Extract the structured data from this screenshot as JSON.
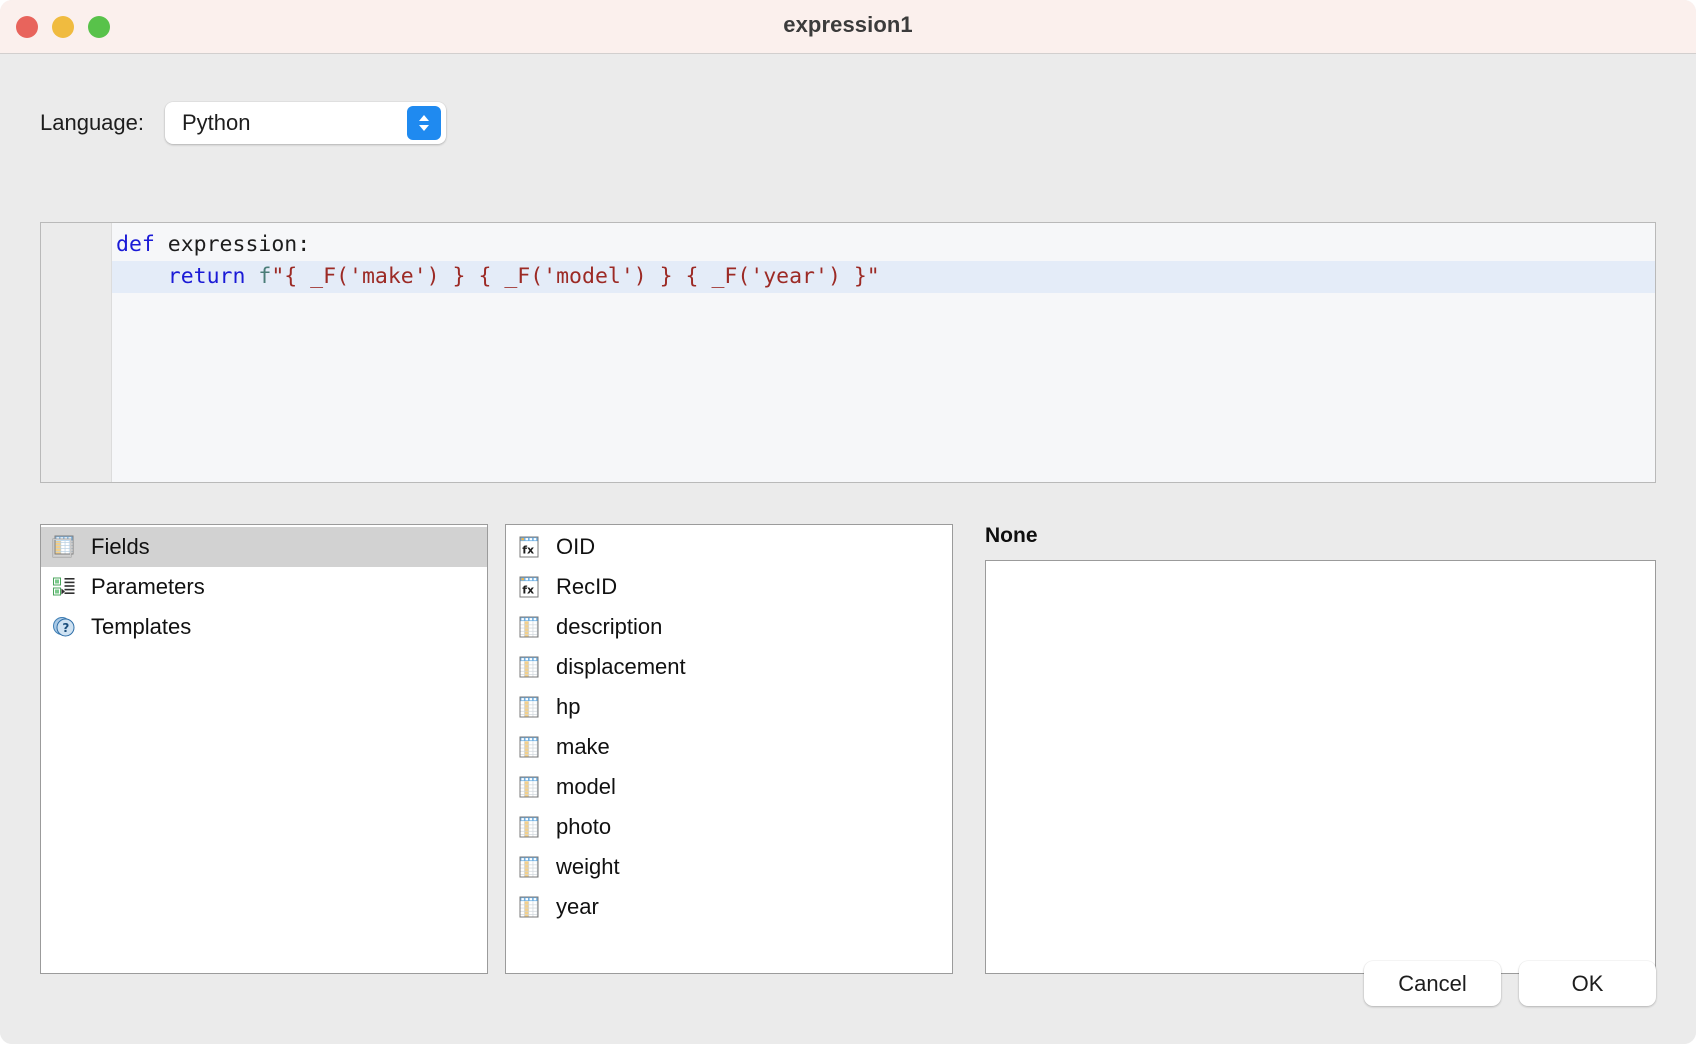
{
  "window": {
    "title": "expression1",
    "traffic_lights": [
      {
        "name": "close-button",
        "color": "#e8645c"
      },
      {
        "name": "minimize-button",
        "color": "#f0bb3f"
      },
      {
        "name": "maximize-button",
        "color": "#58c24a"
      }
    ]
  },
  "language_row": {
    "label": "Language:",
    "selected": "Python",
    "options": [
      "Python"
    ]
  },
  "editor": {
    "lines": [
      {
        "current": false,
        "tokens": [
          {
            "text": "def ",
            "type": "kw"
          },
          {
            "text": "expression:",
            "type": "name"
          }
        ]
      },
      {
        "current": true,
        "tokens": [
          {
            "text": "    ",
            "type": "name"
          },
          {
            "text": "return ",
            "type": "kw"
          },
          {
            "text": "f",
            "type": "pref"
          },
          {
            "text": "\"{ _F('make') } { _F('model') } { _F('year') }\"",
            "type": "str"
          }
        ]
      }
    ]
  },
  "categories_panel": {
    "items": [
      {
        "label": "Fields",
        "icon": "table-grid-icon",
        "selected": true
      },
      {
        "label": "Parameters",
        "icon": "parameters-icon",
        "selected": false
      },
      {
        "label": "Templates",
        "icon": "question-circle-icon",
        "selected": false
      }
    ]
  },
  "fields_panel": {
    "items": [
      {
        "label": "OID",
        "icon": "fx-field-icon"
      },
      {
        "label": "RecID",
        "icon": "fx-field-icon"
      },
      {
        "label": "description",
        "icon": "table-column-icon"
      },
      {
        "label": "displacement",
        "icon": "table-column-icon"
      },
      {
        "label": "hp",
        "icon": "table-column-icon"
      },
      {
        "label": "make",
        "icon": "table-column-icon"
      },
      {
        "label": "model",
        "icon": "table-column-icon"
      },
      {
        "label": "photo",
        "icon": "table-column-icon"
      },
      {
        "label": "weight",
        "icon": "table-column-icon"
      },
      {
        "label": "year",
        "icon": "table-column-icon"
      }
    ]
  },
  "detail_panel": {
    "title": "None",
    "items": []
  },
  "footer": {
    "cancel_label": "Cancel",
    "ok_label": "OK"
  },
  "colors": {
    "titlebar": "#fbf0ed",
    "window_background": "#ebebeb",
    "accent_blue": "#1f8af0",
    "selection_row": "#d2d2d2",
    "current_line": "#e4ecf8",
    "keyword": "#1a1ad6",
    "string": "#9c2a25"
  }
}
